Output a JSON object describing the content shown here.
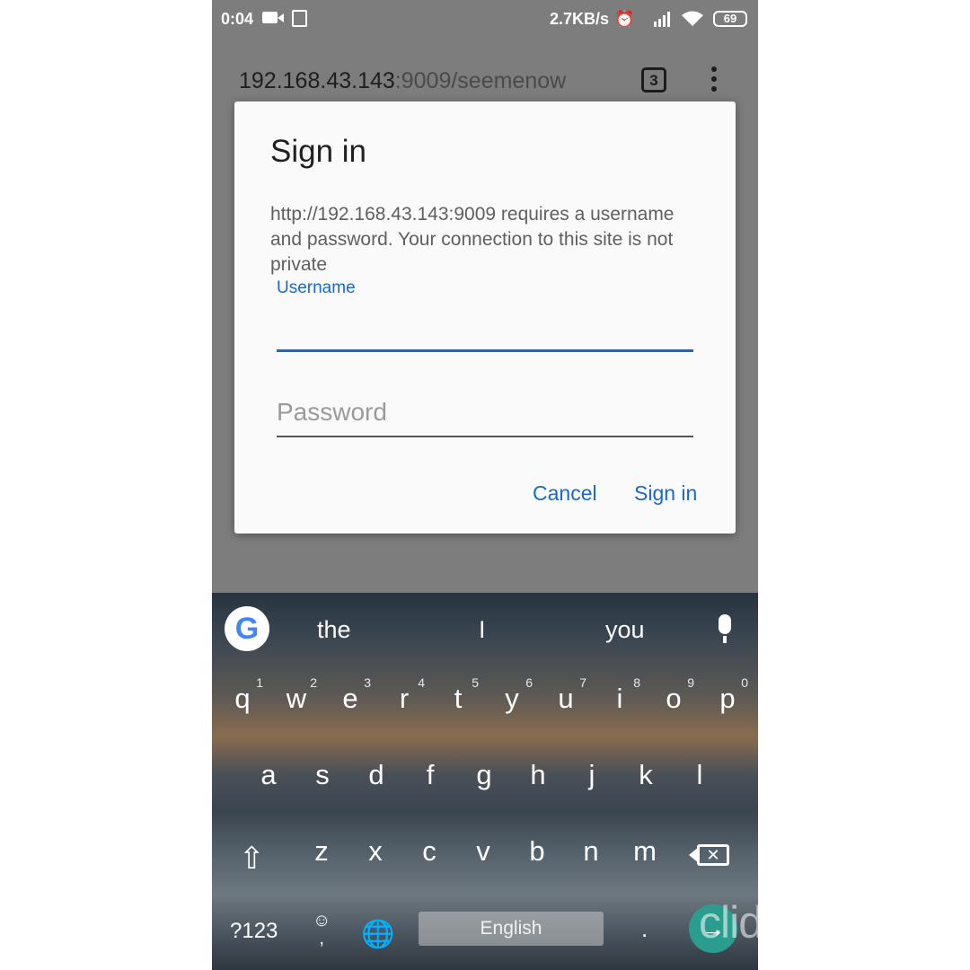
{
  "status_bar": {
    "time": "0:04",
    "net_speed": "2.7KB/s",
    "battery": "69",
    "icons": [
      "video-record-icon",
      "sd-card-icon",
      "alarm-icon",
      "signal-4g-icon",
      "wifi-icon",
      "battery-icon"
    ]
  },
  "browser": {
    "url_host": "192.168.43.143",
    "url_rest": ":9009/seemenow",
    "tab_count": "3"
  },
  "dialog": {
    "title": "Sign in",
    "message": "http://192.168.43.143:9009 requires a username and password. Your connection to this site is not private",
    "username_label": "Username",
    "password_placeholder": "Password",
    "cancel_label": "Cancel",
    "signin_label": "Sign in"
  },
  "keyboard": {
    "suggestions": [
      "the",
      "I",
      "you"
    ],
    "row1": [
      {
        "k": "q",
        "n": "1"
      },
      {
        "k": "w",
        "n": "2"
      },
      {
        "k": "e",
        "n": "3"
      },
      {
        "k": "r",
        "n": "4"
      },
      {
        "k": "t",
        "n": "5"
      },
      {
        "k": "y",
        "n": "6"
      },
      {
        "k": "u",
        "n": "7"
      },
      {
        "k": "i",
        "n": "8"
      },
      {
        "k": "o",
        "n": "9"
      },
      {
        "k": "p",
        "n": "0"
      }
    ],
    "row2": [
      "a",
      "s",
      "d",
      "f",
      "g",
      "h",
      "j",
      "k",
      "l"
    ],
    "row3": [
      "z",
      "x",
      "c",
      "v",
      "b",
      "n",
      "m"
    ],
    "symbols_label": "?123",
    "space_label": "English",
    "emoji_comma": ","
  },
  "watermark": "clideo.com"
}
